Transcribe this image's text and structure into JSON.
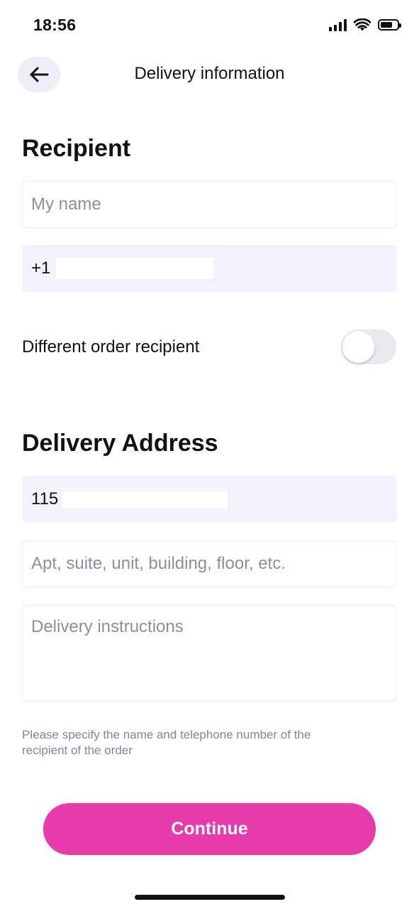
{
  "status_bar": {
    "time": "18:56"
  },
  "header": {
    "title": "Delivery information",
    "back_icon": "arrow-left-icon"
  },
  "recipient": {
    "section_title": "Recipient",
    "name_placeholder": "My name",
    "name_value": "",
    "phone_prefix": "+1",
    "toggle_label": "Different order recipient",
    "toggle_on": false
  },
  "address": {
    "section_title": "Delivery Address",
    "street_value": "115",
    "apt_placeholder": "Apt, suite, unit, building, floor, etc.",
    "instructions_placeholder": "Delivery instructions"
  },
  "hint_text": "Please specify the name and telephone number of the recipient of the order",
  "continue_label": "Continue",
  "colors": {
    "accent": "#e83bab",
    "field_fill": "#f2f2fa",
    "back_button_bg": "#eeeef9",
    "hint": "#85849a"
  }
}
